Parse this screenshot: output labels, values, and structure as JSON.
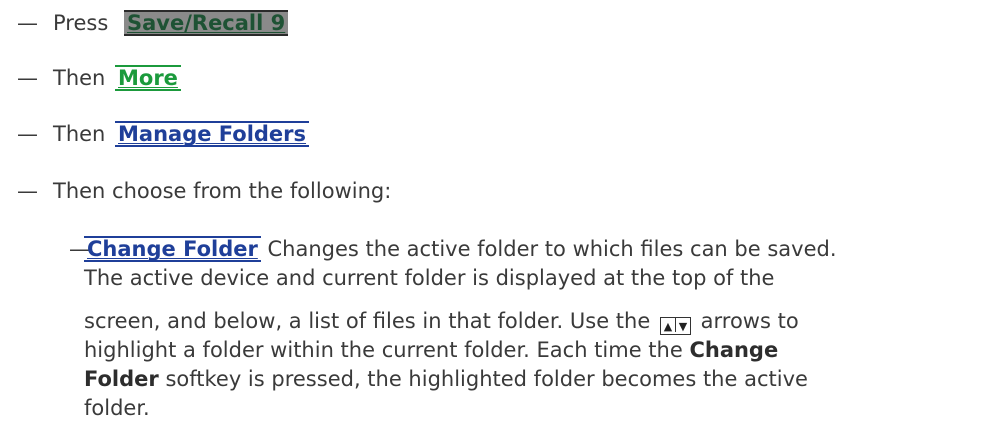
{
  "steps": [
    {
      "dash": "—",
      "prefix": "Press",
      "key": "Save/Recall 9"
    },
    {
      "dash": "—",
      "prefix": "Then",
      "key": "More"
    },
    {
      "dash": "—",
      "prefix": "Then",
      "key": "Manage Folders"
    },
    {
      "dash": "—",
      "text": "Then choose from the following:"
    }
  ],
  "option": {
    "dash": "—",
    "key": "Change Folder",
    "desc_line1": "Changes the active folder to which files can be saved.",
    "line2": "The active device and current folder is displayed at the top of the",
    "line3_a": "screen, and below, a list of files in that folder. Use the",
    "arrow_up": "▲",
    "arrow_down": "▼",
    "line3_b": "arrows to",
    "line4_a": "highlight a folder within the current folder. Each time the",
    "line4_bold": "Change",
    "line5_bold": "Folder",
    "line5_b": "softkey is pressed, the highlighted folder becomes the active",
    "line6": "folder."
  },
  "colors": {
    "hardkey_bg": "#8a8a8a",
    "more_key": "#1b9a3c",
    "softkey": "#1f3f99"
  }
}
